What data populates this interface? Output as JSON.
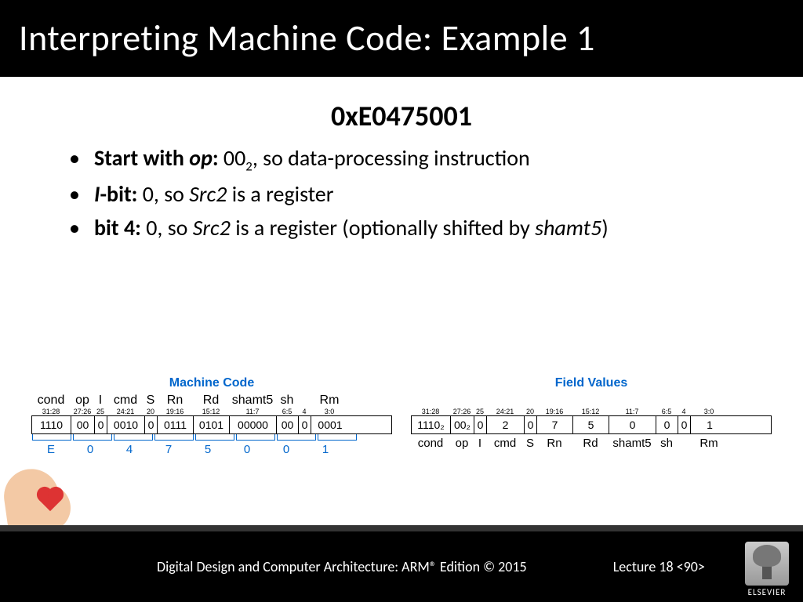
{
  "title": "Interpreting Machine Code: Example 1",
  "hex": "0xE0475001",
  "bullets": {
    "b1": {
      "lead": "Start with ",
      "emph": "op",
      "tail": "00",
      "sub": "2",
      "rest": ", so data-processing instruction"
    },
    "b2": {
      "emph": "I",
      "lead2": "-bit:",
      "tail": " 0, so ",
      "emph2": "Src2",
      "rest": " is a register"
    },
    "b3": {
      "lead": "bit 4:",
      "tail": " 0, so ",
      "emph": "Src2",
      "mid": " is a register (optionally shifted by ",
      "emph2": "shamt5",
      "rest": ")"
    }
  },
  "mc": {
    "title": "Machine Code",
    "top": {
      "cond": "cond",
      "op": "op",
      "i": "I",
      "cmd": "cmd",
      "s": "S",
      "rn": "Rn",
      "rd": "Rd",
      "shamt": "shamt5",
      "sh": "sh",
      "rm": "Rm"
    },
    "bits": {
      "cond": "31:28",
      "op": "27:26",
      "i": "25",
      "cmd": "24:21",
      "s": "20",
      "rn": "19:16",
      "rd": "15:12",
      "shamt": "11:7",
      "sh": "6:5",
      "b4": "4",
      "rm": "3:0"
    },
    "vals": {
      "cond": "1110",
      "op": "00",
      "i": "0",
      "cmd": "0010",
      "s": "0",
      "rn": "0111",
      "rd": "0101",
      "shamt": "00000",
      "sh": "00",
      "b4": "0",
      "rm": "0001"
    },
    "hex": {
      "h0": "E",
      "h1": "0",
      "h2": "4",
      "h3": "7",
      "h4": "5",
      "h5": "0",
      "h6": "0",
      "h7": "1"
    }
  },
  "fv": {
    "title": "Field Values",
    "bits": {
      "cond": "31:28",
      "op": "27:26",
      "i": "25",
      "cmd": "24:21",
      "s": "20",
      "rn": "19:16",
      "rd": "15:12",
      "shamt": "11:7",
      "sh": "6:5",
      "b4": "4",
      "rm": "3:0"
    },
    "vals": {
      "cond": "1110₂",
      "op": "00₂",
      "i": "0",
      "cmd": "2",
      "s": "0",
      "rn": "7",
      "rd": "5",
      "shamt": "0",
      "sh": "0",
      "b4": "0",
      "rm": "1"
    },
    "bot": {
      "cond": "cond",
      "op": "op",
      "i": "I",
      "cmd": "cmd",
      "s": "S",
      "rn": "Rn",
      "rd": "Rd",
      "shamt": "shamt5",
      "sh": "sh",
      "rm": "Rm"
    }
  },
  "footer": {
    "book": "Digital Design and Computer Architecture: ARM® Edition © 2015",
    "lecture": "Lecture 18 <90>",
    "publisher": "ELSEVIER"
  }
}
